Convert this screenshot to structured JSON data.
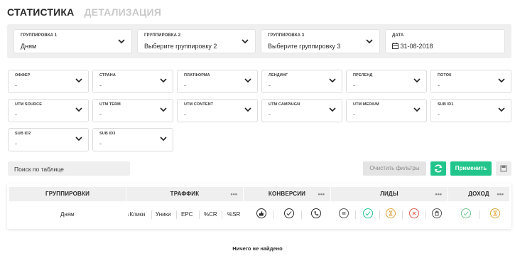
{
  "tabs": {
    "statistics": "СТАТИСТИКА",
    "details": "ДЕТАЛИЗАЦИЯ"
  },
  "grouping": {
    "g1": {
      "label": "ГРУППИРОВКА 1",
      "value": "Дням"
    },
    "g2": {
      "label": "ГРУППИРОВКА 2",
      "value": "Выберите группировку 2"
    },
    "g3": {
      "label": "ГРУППИРОВКА 3",
      "value": "Выберите группировку 3"
    },
    "date": {
      "label": "ДАТА",
      "value": "31-08-2018"
    }
  },
  "filters": {
    "offer": {
      "label": "ОФФЕР",
      "value": "-"
    },
    "country": {
      "label": "СТРАНА",
      "value": "-"
    },
    "platform": {
      "label": "ПЛАТФОРМА",
      "value": "-"
    },
    "landing": {
      "label": "ЛЕНДИНГ",
      "value": "-"
    },
    "prelanding": {
      "label": "ПРЕЛЕНД",
      "value": "-"
    },
    "flow": {
      "label": "ПОТОК",
      "value": "-"
    },
    "utm_source": {
      "label": "UTM SOURCE",
      "value": "-"
    },
    "utm_term": {
      "label": "UTM TERM",
      "value": "-"
    },
    "utm_content": {
      "label": "UTM CONTENT",
      "value": "-"
    },
    "utm_campaign": {
      "label": "UTM CAMPAIGN",
      "value": "-"
    },
    "utm_medium": {
      "label": "UTM MEDIUM",
      "value": "-"
    },
    "sub_id1": {
      "label": "SUB ID1",
      "value": "-"
    },
    "sub_id2": {
      "label": "SUB ID2",
      "value": "-"
    },
    "sub_id3": {
      "label": "SUB ID3",
      "value": "-"
    }
  },
  "toolbar": {
    "search_placeholder": "Поиск по таблице",
    "clear_label": "Очистить фильтры",
    "apply_label": "Применить"
  },
  "table": {
    "headers": {
      "groupings": "ГРУППИРОВКИ",
      "traffic": "ТРАФФИК",
      "conversions": "КОНВЕРСИИ",
      "leads": "ЛИДЫ",
      "income": "ДОХОД"
    },
    "more": "•••",
    "row_label": "Дням",
    "traffic_metrics": [
      "Клики",
      "Уники",
      "EPC",
      "%CR",
      "%SR"
    ],
    "sort_marker": "↓"
  },
  "empty_message": "Ничего не найдено",
  "colors": {
    "accent": "#22c58b",
    "panel": "#efefef"
  }
}
